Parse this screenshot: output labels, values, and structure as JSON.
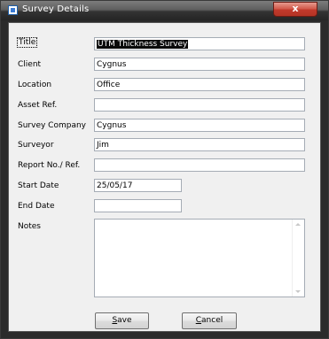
{
  "window": {
    "title": "Survey Details",
    "close_label": "x"
  },
  "form": {
    "fields": [
      {
        "label": "Title",
        "value": "UTM Thickness Survey"
      },
      {
        "label": "Client",
        "value": "Cygnus"
      },
      {
        "label": "Location",
        "value": "Office"
      },
      {
        "label": "Asset Ref.",
        "value": ""
      },
      {
        "label": "Survey Company",
        "value": "Cygnus"
      },
      {
        "label": "Surveyor",
        "value": "Jim"
      },
      {
        "label": "Report No./ Ref.",
        "value": ""
      },
      {
        "label": "Start Date",
        "value": "25/05/17"
      },
      {
        "label": "End Date",
        "value": ""
      },
      {
        "label": "Notes",
        "value": ""
      }
    ]
  },
  "buttons": {
    "save": {
      "mnemonic": "S",
      "rest": "ave"
    },
    "cancel": {
      "mnemonic": "C",
      "rest": "ancel"
    }
  }
}
